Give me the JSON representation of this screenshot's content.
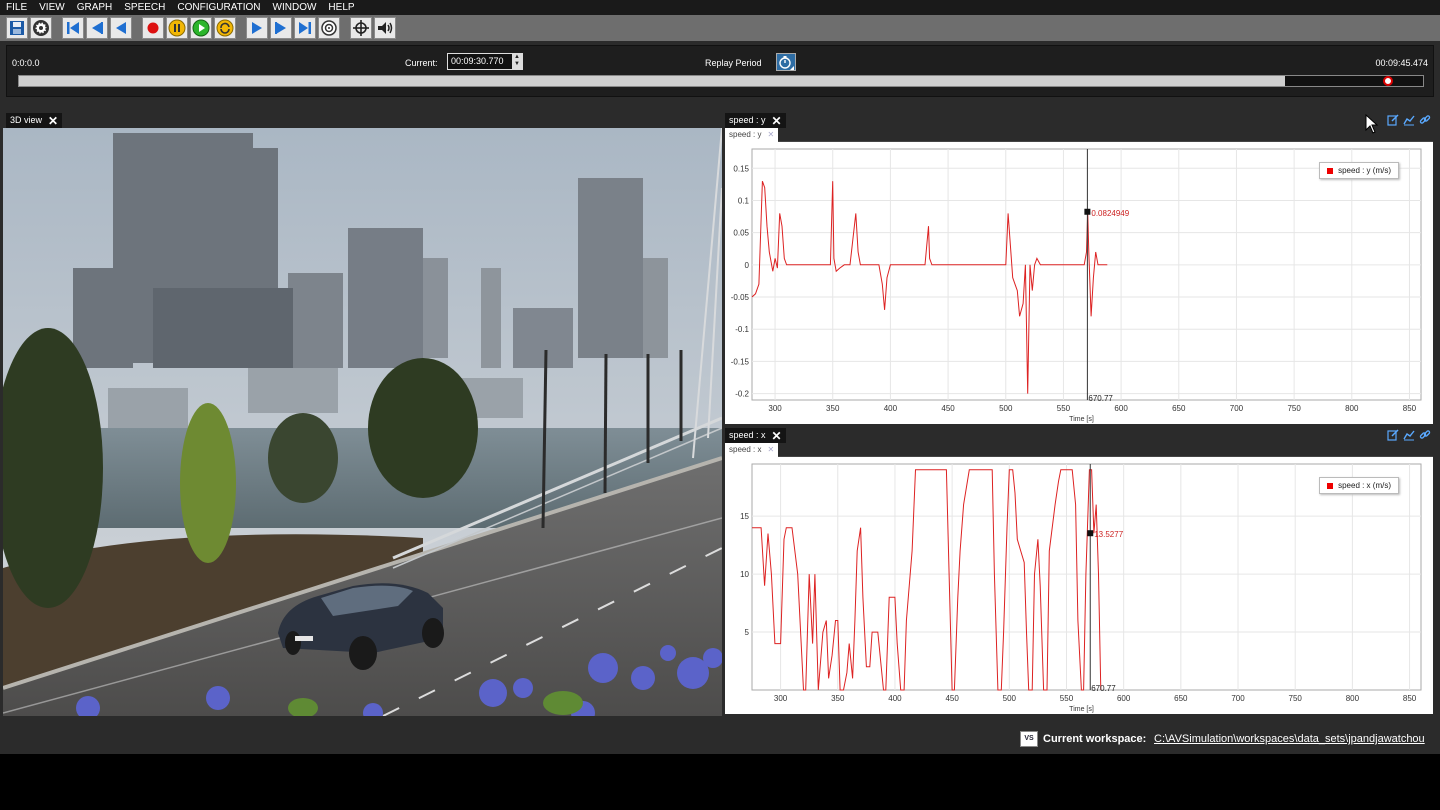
{
  "menu": [
    "FILE",
    "VIEW",
    "GRAPH",
    "SPEECH",
    "CONFIGURATION",
    "WINDOW",
    "HELP"
  ],
  "toolbar": {
    "buttons": [
      {
        "icon": "save-icon"
      },
      {
        "icon": "settings-gear-icon"
      },
      {
        "icon": "skip-to-start-icon"
      },
      {
        "icon": "step-back-icon"
      },
      {
        "icon": "play-backward-icon"
      },
      {
        "icon": "record-icon",
        "color": "#dd1111"
      },
      {
        "icon": "pause-icon",
        "color": "#f2b705"
      },
      {
        "icon": "play-icon",
        "color": "#2bb52b"
      },
      {
        "icon": "loop-icon",
        "color": "#f2b705"
      },
      {
        "icon": "play-forward-icon"
      },
      {
        "icon": "step-forward-icon"
      },
      {
        "icon": "skip-to-end-icon"
      },
      {
        "icon": "target-settings-icon"
      },
      {
        "icon": "crosshair-icon"
      },
      {
        "icon": "speaker-icon"
      }
    ]
  },
  "timeline": {
    "start": "0:0:0.0",
    "current_label": "Current:",
    "current_value": "00:09:30.770",
    "replay_label": "Replay Period",
    "end": "00:09:45.474",
    "played_fraction": 0.902,
    "knob_fraction": 0.975
  },
  "view3d": {
    "tab_label": "3D view",
    "close": "✕"
  },
  "graphs": [
    {
      "tab_label": "speed : y",
      "subtab_label": "speed : y",
      "legend": "speed : y (m/s)",
      "cursor_x_label": "670.77",
      "cursor_value_label": "0.0824949",
      "xlabel": "Time [s]",
      "chart_data": {
        "type": "line",
        "xlim": [
          280,
          860
        ],
        "ylim": [
          -0.21,
          0.18
        ],
        "xticks": [
          300,
          350,
          400,
          450,
          500,
          550,
          600,
          650,
          700,
          750,
          800,
          850
        ],
        "yticks": [
          0.15,
          0.1,
          0.05,
          0,
          -0.05,
          -0.1,
          -0.15,
          -0.2
        ],
        "ytick_labels": [
          "0.15",
          "0.1",
          "0.05",
          "0",
          "-0.05",
          "-0.1",
          "-0.15",
          "-0.2"
        ],
        "cursor_x": 570.77,
        "cursor_y": 0.0824949,
        "series": [
          {
            "name": "speed : y (m/s)",
            "color": "#dd2222",
            "x": [
              280,
              283,
              286,
              289,
              291,
              293,
              295,
              298,
              300,
              302,
              304,
              306,
              308,
              310,
              312,
              315,
              320,
              330,
              340,
              348,
              350,
              351,
              353,
              356,
              360,
              365,
              370,
              372,
              374,
              376,
              380,
              385,
              390,
              393,
              395,
              397,
              400,
              410,
              420,
              430,
              433,
              434,
              436,
              440,
              450,
              460,
              470,
              480,
              490,
              500,
              502,
              504,
              506,
              508,
              510,
              512,
              515,
              517,
              519,
              521,
              523,
              525,
              527,
              530,
              535,
              540,
              545,
              550,
              555,
              560,
              565,
              568,
              570,
              571,
              572,
              574,
              576,
              578,
              580,
              582,
              584,
              586,
              588
            ],
            "y": [
              -0.05,
              -0.045,
              -0.03,
              0.13,
              0.12,
              0.06,
              0.02,
              -0.01,
              0.01,
              -0.005,
              0.08,
              0.06,
              0.01,
              0.0,
              0.0,
              0.0,
              0.0,
              0.0,
              0.0,
              0.0,
              0.13,
              0.01,
              -0.01,
              -0.005,
              0.0,
              0.0,
              0.08,
              0.02,
              0.0,
              0.0,
              0.0,
              0.0,
              0.0,
              -0.03,
              -0.07,
              -0.02,
              0.0,
              0.0,
              0.0,
              0.0,
              0.06,
              0.01,
              0.0,
              0.0,
              0.0,
              0.0,
              0.0,
              0.0,
              0.0,
              0.0,
              0.08,
              0.03,
              -0.02,
              -0.03,
              -0.04,
              -0.08,
              -0.06,
              0.0,
              -0.2,
              0.0,
              -0.04,
              0.0,
              0.01,
              0.0,
              0.0,
              0.0,
              0.0,
              0.0,
              0.0,
              0.0,
              0.0,
              0.0,
              0.02,
              0.0824949,
              0.02,
              -0.08,
              -0.02,
              0.02,
              0.0,
              0.0,
              0.0,
              0.0,
              0.0
            ]
          }
        ]
      }
    },
    {
      "tab_label": "speed : x",
      "subtab_label": "speed : x",
      "legend": "speed : x (m/s)",
      "cursor_x_label": "670.77",
      "cursor_value_label": "13.5277",
      "xlabel": "Time [s]",
      "chart_data": {
        "type": "line",
        "xlim": [
          275,
          860
        ],
        "ylim": [
          0,
          19.5
        ],
        "xticks": [
          300,
          350,
          400,
          450,
          500,
          550,
          600,
          650,
          700,
          750,
          800,
          850
        ],
        "yticks": [
          15,
          10,
          5
        ],
        "ytick_labels": [
          "15",
          "10",
          "5"
        ],
        "cursor_x": 570.77,
        "cursor_y": 13.5277,
        "series": [
          {
            "name": "speed : x (m/s)",
            "color": "#dd2222",
            "x": [
              275,
              280,
              283,
              286,
              289,
              292,
              295,
              300,
              303,
              305,
              307,
              310,
              315,
              320,
              322,
              325,
              328,
              330,
              333,
              337,
              340,
              342,
              345,
              348,
              350,
              352,
              355,
              358,
              360,
              363,
              365,
              367,
              370,
              372,
              375,
              378,
              380,
              383,
              385,
              390,
              392,
              395,
              400,
              402,
              405,
              408,
              410,
              415,
              418,
              420,
              425,
              430,
              435,
              440,
              445,
              450,
              452,
              455,
              457,
              460,
              465,
              470,
              475,
              480,
              485,
              487,
              490,
              493,
              495,
              498,
              500,
              503,
              505,
              507,
              510,
              513,
              515,
              517,
              520,
              522,
              525,
              527,
              530,
              533,
              535,
              540,
              543,
              545,
              547,
              550,
              553,
              555,
              558,
              560,
              563,
              565,
              567,
              570,
              572,
              574,
              576,
              578,
              580
            ],
            "y": [
              14,
              14,
              14,
              9,
              13.5,
              10,
              4,
              4,
              13,
              14,
              14,
              14,
              10,
              0,
              0,
              10,
              4,
              10,
              0,
              5,
              6,
              1,
              3,
              6,
              6,
              0,
              0,
              1.5,
              4,
              1,
              6,
              12,
              14,
              8,
              2,
              2,
              5,
              5,
              5,
              0,
              0,
              8,
              8,
              4,
              0,
              0,
              6,
              12,
              19,
              19,
              19,
              19,
              19,
              19,
              19,
              0,
              0,
              8,
              12,
              16,
              19,
              19,
              19,
              19,
              19,
              10,
              0,
              0,
              5,
              14,
              19,
              19,
              17,
              13,
              12,
              11,
              5,
              0,
              0,
              10,
              13,
              9,
              0,
              0,
              12,
              16,
              18,
              19,
              19,
              19,
              19,
              19,
              16,
              6,
              0,
              0,
              10,
              19,
              19,
              13.5277,
              16,
              10,
              0
            ]
          }
        ]
      }
    }
  ],
  "status": {
    "workspace_icon": "VS",
    "workspace_label": "Current workspace:",
    "workspace_path": "C:\\AVSimulation\\workspaces\\data_sets\\jpandjawatchou"
  },
  "colors": {
    "accent": "#dd2222",
    "menu_bg": "#1a1a1a",
    "toolbar_bg": "#6e6e6e",
    "panel_bg": "#2b2b2b"
  }
}
